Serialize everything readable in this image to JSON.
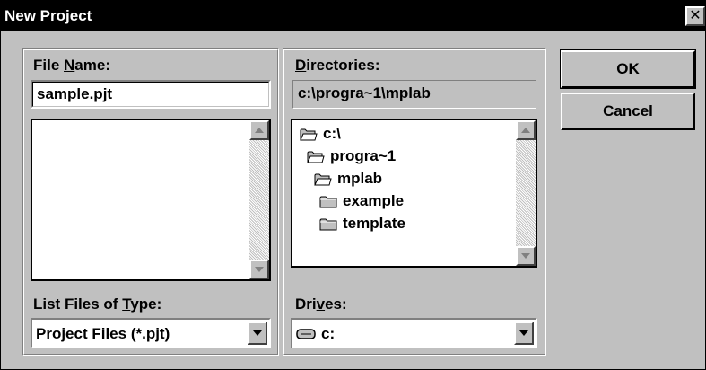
{
  "window": {
    "title": "New Project",
    "close_glyph": "✕"
  },
  "file_name": {
    "label_pre": "File ",
    "label_accel": "N",
    "label_post": "ame:",
    "value": "sample.pjt"
  },
  "list_files_type": {
    "label_pre": "List Files of ",
    "label_accel": "T",
    "label_post": "ype:",
    "selected": "Project Files (*.pjt)"
  },
  "directories": {
    "label_pre": "",
    "label_accel": "D",
    "label_post": "irectories:",
    "current_path": "c:\\progra~1\\mplab",
    "tree": [
      {
        "label": "c:\\",
        "icon": "open-folder-icon"
      },
      {
        "label": "progra~1",
        "icon": "open-folder-icon"
      },
      {
        "label": "mplab",
        "icon": "open-folder-icon"
      },
      {
        "label": "example",
        "icon": "folder-icon"
      },
      {
        "label": "template",
        "icon": "folder-icon"
      }
    ]
  },
  "drives": {
    "label_pre": "Dri",
    "label_accel": "v",
    "label_post": "es:",
    "selected": "c:",
    "icon": "drive-icon"
  },
  "buttons": {
    "ok": "OK",
    "cancel": "Cancel"
  }
}
